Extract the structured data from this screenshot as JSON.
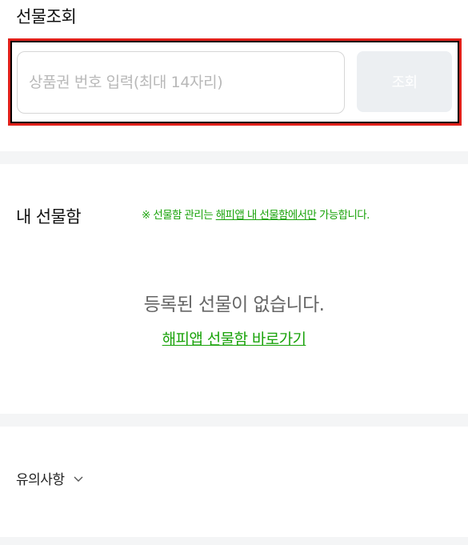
{
  "gift_inquiry": {
    "title": "선물조회",
    "input_placeholder": "상품권 번호 입력(최대 14자리)",
    "search_button": "조회"
  },
  "gift_box": {
    "title": "내 선물함",
    "notice_prefix": "※ 선물함 관리는 ",
    "notice_link": "해피앱 내 선물함에서만",
    "notice_suffix": " 가능합니다.",
    "empty_message": "등록된 선물이 없습니다.",
    "app_link": "해피앱 선물함 바로가기"
  },
  "notes": {
    "label": "유의사항",
    "icon": "chevron-down-icon"
  },
  "colors": {
    "accent_green": "#1aa30b",
    "highlight_red": "#e0201a",
    "button_disabled_bg": "#eceff2",
    "divider": "#f4f5f6"
  }
}
